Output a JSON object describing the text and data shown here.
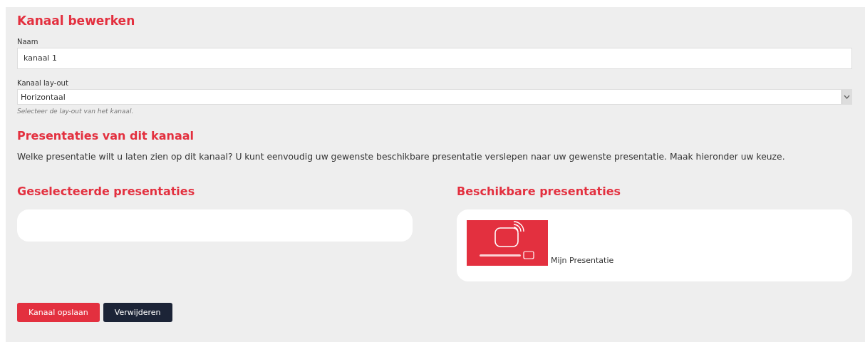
{
  "title": "Kanaal bewerken",
  "name_field": {
    "label": "Naam",
    "value": "kanaal 1"
  },
  "layout_field": {
    "label": "Kanaal lay-out",
    "value": "Horizontaal",
    "help": "Selecteer de lay-out van het kanaal."
  },
  "section": {
    "title": "Presentaties van dit kanaal",
    "description": "Welke presentatie wilt u laten zien op dit kanaal? U kunt eenvoudig uw gewenste beschikbare presentatie verslepen naar uw gewenste presentatie. Maak hieronder uw keuze."
  },
  "selected_list": {
    "title": "Geselecteerde presentaties"
  },
  "available_list": {
    "title": "Beschikbare presentaties",
    "items": [
      {
        "kind": "picture",
        "name": "Mijn Presentatie"
      }
    ]
  },
  "buttons": [
    {
      "label": "Kanaal opslaan",
      "kind": "primary"
    },
    {
      "label": "Verwijderen",
      "kind": "secondary"
    }
  ]
}
